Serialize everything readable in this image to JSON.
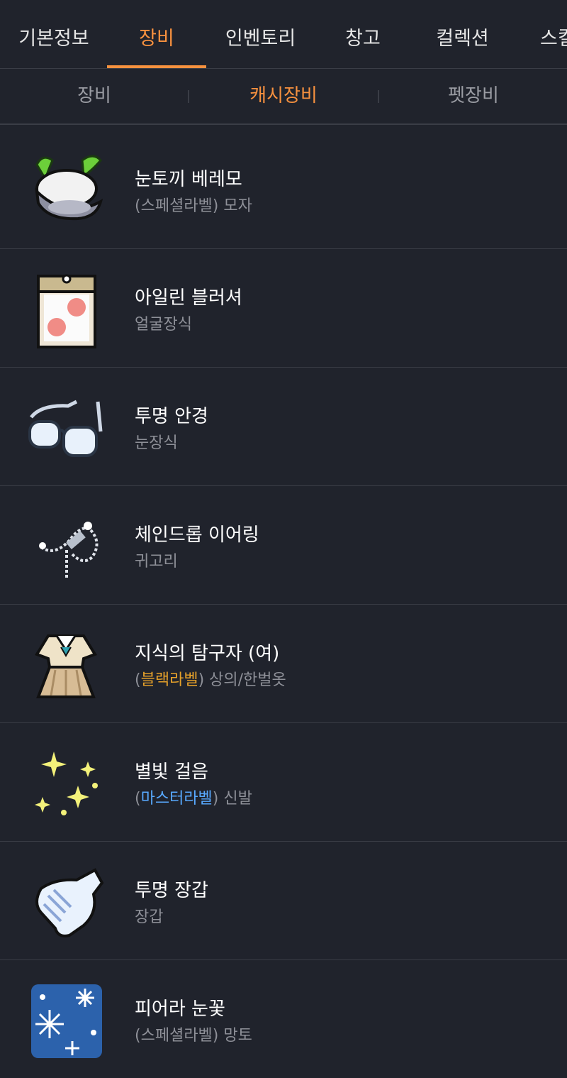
{
  "tabs": [
    "기본정보",
    "장비",
    "인벤토리",
    "창고",
    "컬렉션",
    "스킬"
  ],
  "active_tab": "장비",
  "subtabs": [
    "장비",
    "캐시장비",
    "펫장비"
  ],
  "active_subtab": "캐시장비",
  "items": [
    {
      "name": "눈토끼 베레모",
      "prefix": "(",
      "label": "스페셜라벨",
      "suffix": ")",
      "category": "모자",
      "label_color": "gray",
      "icon": "snow-rabbit-beret-icon"
    },
    {
      "name": "아일린 블러셔",
      "category": "얼굴장식",
      "icon": "blusher-face-accessory-icon"
    },
    {
      "name": "투명 안경",
      "category": "눈장식",
      "icon": "glasses-icon"
    },
    {
      "name": "체인드롭 이어링",
      "category": "귀고리",
      "icon": "chain-earring-icon"
    },
    {
      "name": "지식의 탐구자 (여)",
      "prefix": "(",
      "label": "블랙라벨",
      "suffix": ")",
      "category": "상의/한벌옷",
      "label_color": "gold",
      "icon": "school-uniform-icon"
    },
    {
      "name": "별빛 걸음",
      "prefix": "(",
      "label": "마스터라벨",
      "suffix": ")",
      "category": "신발",
      "label_color": "blue",
      "icon": "sparkle-shoes-icon"
    },
    {
      "name": "투명 장갑",
      "category": "장갑",
      "icon": "glove-icon"
    },
    {
      "name": "피어라 눈꽃",
      "prefix": "(",
      "label": "스페셜라벨",
      "suffix": ")",
      "category": "망토",
      "label_color": "gray",
      "icon": "snowflake-cape-icon"
    }
  ],
  "colors": {
    "background": "#20232c",
    "accent": "#f7913f",
    "gold_label": "#e7a22a",
    "blue_label": "#58a9ff",
    "divider": "#3a3d46"
  }
}
